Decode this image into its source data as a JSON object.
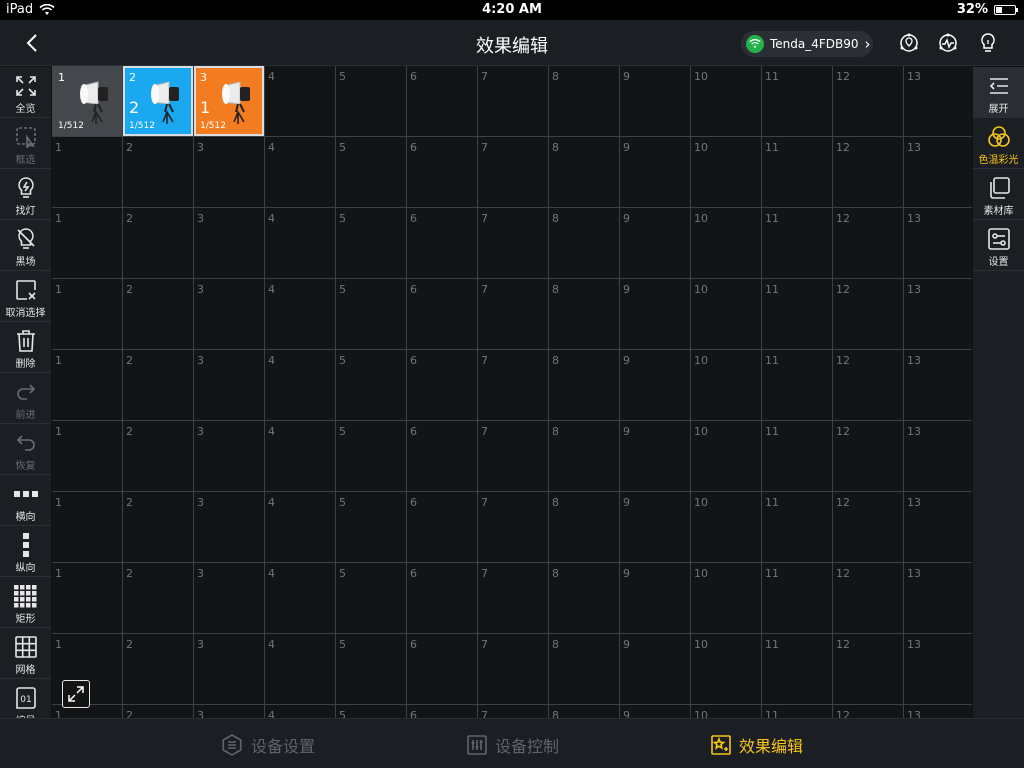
{
  "status": {
    "device": "iPad",
    "time": "4:20 AM",
    "battery": "32%",
    "battery_level": 0.32
  },
  "header": {
    "title": "效果编辑",
    "wifi_name": "Tenda_4FDB90",
    "chevron": "›"
  },
  "left_tools": [
    {
      "id": "select-all",
      "label": "全览",
      "icon": "fullscreen-icon",
      "disabled": false
    },
    {
      "id": "box-select",
      "label": "框选",
      "icon": "box-select-icon",
      "disabled": true
    },
    {
      "id": "find-light",
      "label": "找灯",
      "icon": "bulb-icon",
      "disabled": false
    },
    {
      "id": "blackout",
      "label": "黑场",
      "icon": "bulb-off-icon",
      "disabled": false
    },
    {
      "id": "deselect",
      "label": "取消选择",
      "icon": "deselect-icon",
      "disabled": false
    },
    {
      "id": "delete",
      "label": "删除",
      "icon": "trash-icon",
      "disabled": false
    },
    {
      "id": "forward",
      "label": "前进",
      "icon": "redo-icon",
      "disabled": true
    },
    {
      "id": "restore",
      "label": "恢复",
      "icon": "undo-icon",
      "disabled": true
    },
    {
      "id": "horizontal",
      "label": "横向",
      "icon": "horizontal-layout-icon",
      "disabled": false
    },
    {
      "id": "vertical",
      "label": "纵向",
      "icon": "vertical-layout-icon",
      "disabled": false
    },
    {
      "id": "rectangle",
      "label": "矩形",
      "icon": "rectangle-layout-icon",
      "disabled": false
    },
    {
      "id": "grid",
      "label": "网格",
      "icon": "grid-icon",
      "disabled": false
    },
    {
      "id": "number",
      "label": "编号",
      "icon": "number-icon",
      "disabled": false
    }
  ],
  "right_tools": [
    {
      "id": "expand",
      "label": "展开",
      "icon": "expand-list-icon"
    },
    {
      "id": "cct",
      "label": "色温彩光",
      "icon": "color-circles-icon"
    },
    {
      "id": "library",
      "label": "素材库",
      "icon": "library-icon"
    },
    {
      "id": "settings",
      "label": "设置",
      "icon": "settings-icon"
    }
  ],
  "grid": {
    "columns": [
      "1",
      "2",
      "3",
      "4",
      "5",
      "6",
      "7",
      "8",
      "9",
      "10",
      "11",
      "12",
      "13"
    ],
    "rows": 10
  },
  "tiles": [
    {
      "num": "1",
      "addr": "1/512",
      "big": "",
      "color": "#44474c"
    },
    {
      "num": "2",
      "addr": "1/512",
      "big": "2",
      "color": "#1aa9f0"
    },
    {
      "num": "3",
      "addr": "1/512",
      "big": "1",
      "color": "#f47c20"
    }
  ],
  "bottom_tabs": [
    {
      "label": "设备设置",
      "icon": "device-settings-icon",
      "active": false
    },
    {
      "label": "设备控制",
      "icon": "device-control-icon",
      "active": false
    },
    {
      "label": "效果编辑",
      "icon": "effect-edit-icon",
      "active": true
    }
  ],
  "colors": {
    "accent": "#f5c518",
    "wifi": "#21b24a"
  }
}
